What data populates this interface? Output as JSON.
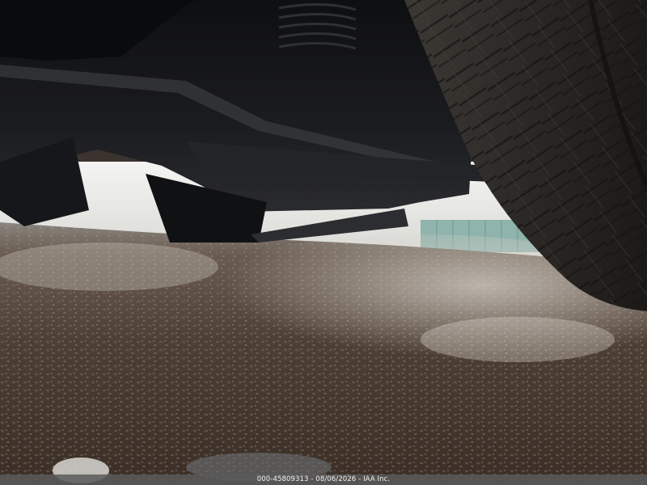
{
  "photo": {
    "caption": "000-45809313 - 08/06/2026 - IAA Inc."
  },
  "colors": {
    "ground_dark": "#3b2f27",
    "ground_mid": "#5a4a3e",
    "ground_wet_highlight": "#c9c4bc",
    "undercarriage": "#151618",
    "tire": "#2a2826",
    "sky_gap": "#e6e6e4",
    "fence": "#8fb3ad",
    "caption_bar": "#5a5a5a"
  }
}
